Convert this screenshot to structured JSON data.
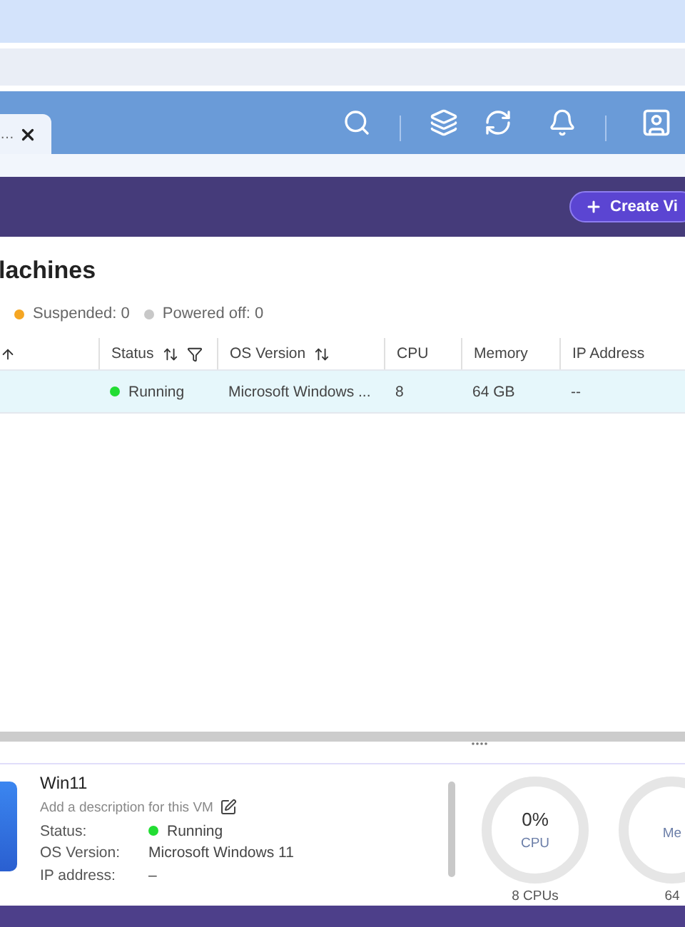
{
  "tab": {
    "label": "…"
  },
  "create_button": {
    "label": "Create Vi"
  },
  "page_title": "lachines",
  "legend": [
    {
      "label": "Suspended: 0",
      "color": "#f5a623"
    },
    {
      "label": "Powered off: 0",
      "color": "#c8c8c8"
    }
  ],
  "table": {
    "columns": [
      {
        "sortable": true,
        "filterable": false
      },
      {
        "label": "Status",
        "sortable": true,
        "filterable": true
      },
      {
        "label": "OS Version",
        "sortable": true,
        "filterable": false
      },
      {
        "label": "CPU",
        "sortable": false,
        "filterable": false
      },
      {
        "label": "Memory",
        "sortable": false,
        "filterable": false
      },
      {
        "label": "IP Address",
        "sortable": false,
        "filterable": false
      }
    ],
    "rows": [
      {
        "selected": true,
        "status": "Running",
        "color": "#22dd33",
        "os": "Microsoft Windows ...",
        "cpu": "8",
        "memory": "64 GB",
        "ip": "--"
      }
    ]
  },
  "details": {
    "name": "Win11",
    "description_placeholder": "Add a description for this VM",
    "fields": [
      {
        "label": "Status:",
        "value": "Running",
        "color": "#22dd33"
      },
      {
        "label": "OS Version:",
        "value": "Microsoft Windows 11"
      },
      {
        "label": "IP address:",
        "value": "–"
      }
    ],
    "gauges": [
      {
        "value": "0%",
        "label": "CPU",
        "caption": "8 CPUs",
        "level": 0
      },
      {
        "label": "Me",
        "caption": "64",
        "level": 0
      }
    ]
  }
}
